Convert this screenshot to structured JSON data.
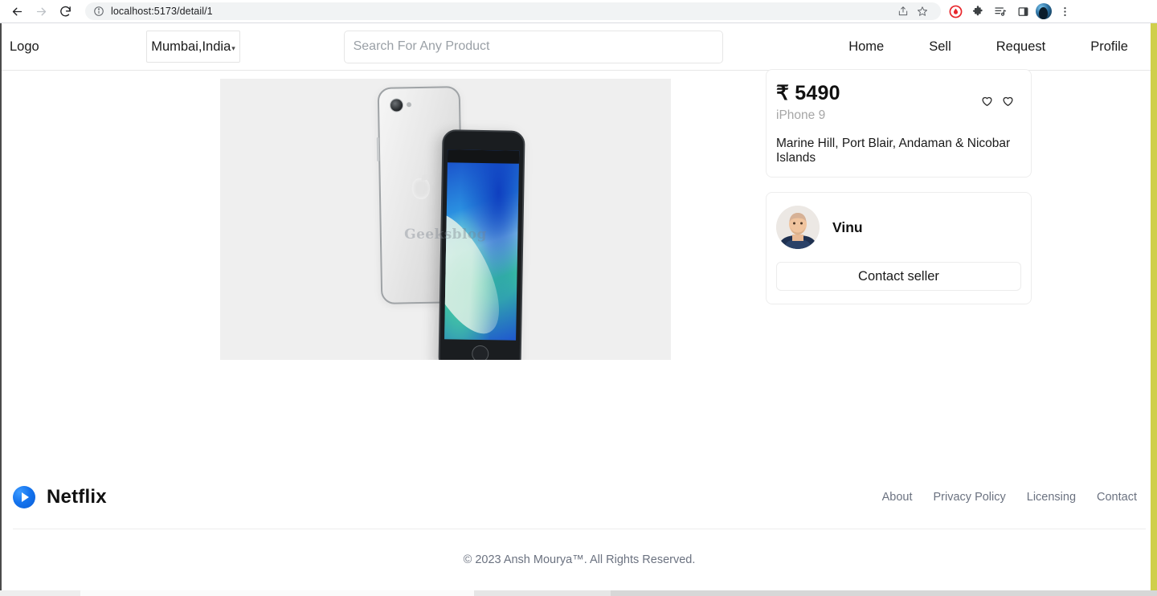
{
  "browser": {
    "back_icon": "back-arrow-icon",
    "forward_icon": "forward-arrow-icon",
    "reload_icon": "reload-icon",
    "site_info_icon": "site-info-icon",
    "url": "localhost:5173/detail/1",
    "share_icon": "share-icon",
    "bookmark_icon": "bookmark-star-icon",
    "adblock_icon": "adblock-shield-icon",
    "extensions_icon": "extensions-puzzle-icon",
    "reading_list_icon": "reading-list-icon",
    "side_panel_icon": "side-panel-icon",
    "profile_icon": "browser-profile-avatar",
    "menu_icon": "three-dot-menu-icon"
  },
  "header": {
    "logo": "Logo",
    "location": "Mumbai,India",
    "location_caret": "▾",
    "search": {
      "value": "",
      "placeholder": "Search For Any Product"
    },
    "nav": [
      {
        "label": "Home"
      },
      {
        "label": "Sell"
      },
      {
        "label": "Request"
      },
      {
        "label": "Profile"
      }
    ]
  },
  "product": {
    "image_alt": "iPhone 9 silver back and black front",
    "image_watermark": "Geeksblog",
    "price": "₹ 5490",
    "title": "iPhone 9",
    "location": "Marine Hill, Port Blair, Andaman & Nicobar Islands",
    "favorite_icon": "heart-outline-icon",
    "wishlist_icon": "heart-outline-icon"
  },
  "seller": {
    "name": "Vinu",
    "avatar_alt": "seller profile photo",
    "contact_label": "Contact seller"
  },
  "footer": {
    "brand": "Netflix",
    "brand_icon": "play-circle-icon",
    "links": [
      {
        "label": "About"
      },
      {
        "label": "Privacy Policy"
      },
      {
        "label": "Licensing"
      },
      {
        "label": "Contact"
      }
    ],
    "copyright": "© 2023 Ansh Mourya™. All Rights Reserved."
  },
  "colors": {
    "accent_blue": "#1574ee",
    "image_bg": "#efefef",
    "card_border": "#ededed",
    "muted_text": "#6b7280",
    "edge_strip": "#cfcf4c"
  }
}
